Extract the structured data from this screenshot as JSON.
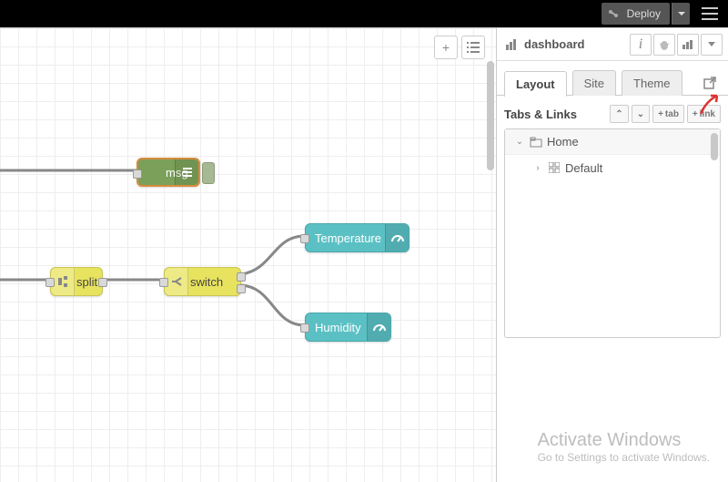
{
  "topbar": {
    "deploy_label": "Deploy"
  },
  "canvas": {
    "nodes": {
      "debug": "msg",
      "split": "split",
      "switch": "switch",
      "temp": "Temperature",
      "humidity": "Humidity"
    }
  },
  "sidebar": {
    "title": "dashboard",
    "tabs": {
      "layout": "Layout",
      "site": "Site",
      "theme": "Theme"
    },
    "section_title": "Tabs & Links",
    "buttons": {
      "tab": "tab",
      "link": "link"
    },
    "tree": {
      "home": "Home",
      "default": "Default"
    }
  },
  "watermark": {
    "line1": "Activate Windows",
    "line2": "Go to Settings to activate Windows."
  }
}
